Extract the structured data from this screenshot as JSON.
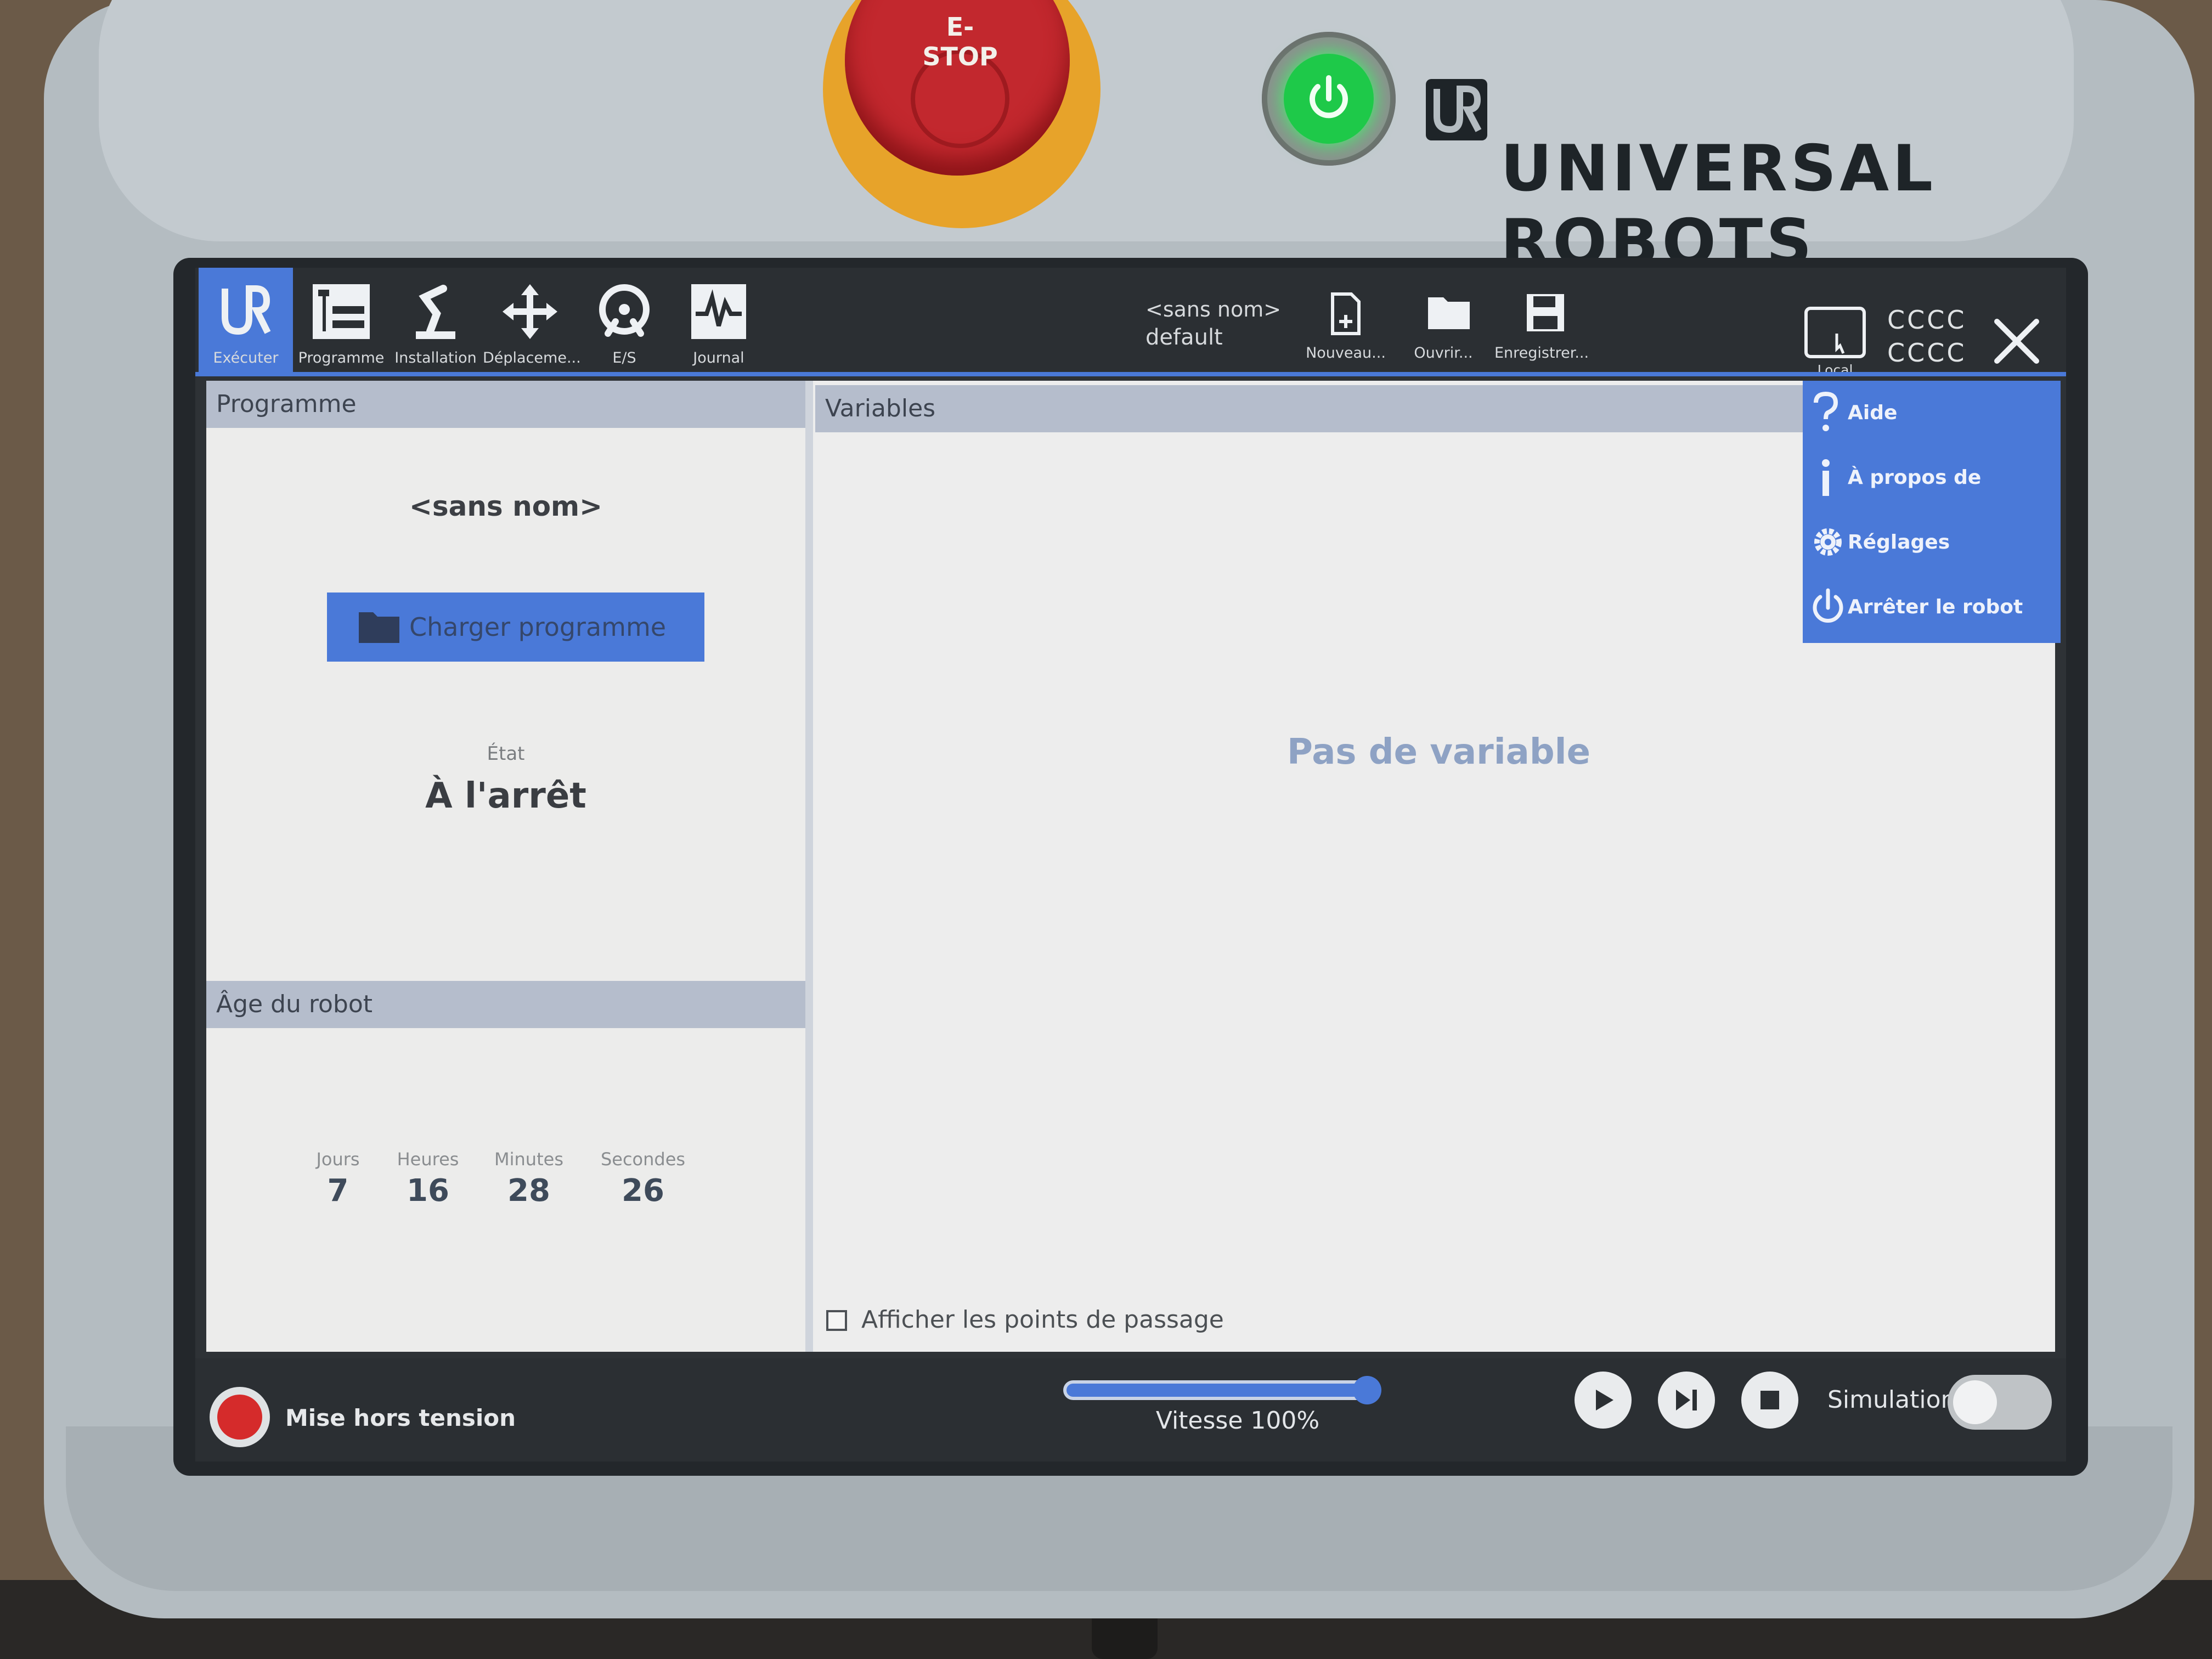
{
  "estop": {
    "label": "E-STOP"
  },
  "brand": {
    "name": "UNIVERSAL ROBOTS"
  },
  "tabs": [
    {
      "label": "Exécuter",
      "icon": "ur-logo-icon",
      "active": true
    },
    {
      "label": "Programme",
      "icon": "program-tree-icon"
    },
    {
      "label": "Installation",
      "icon": "robot-arm-icon"
    },
    {
      "label": "Déplaceme...",
      "icon": "move-arrows-icon"
    },
    {
      "label": "E/S",
      "icon": "io-icon"
    },
    {
      "label": "Journal",
      "icon": "log-wave-icon"
    }
  ],
  "program_header": {
    "name": "<sans nom>",
    "installation": "default"
  },
  "file_buttons": [
    {
      "label": "Nouveau...",
      "icon": "new-file-icon"
    },
    {
      "label": "Ouvrir...",
      "icon": "folder-icon"
    },
    {
      "label": "Enregistrer...",
      "icon": "save-icon"
    }
  ],
  "mode": {
    "label": "Local",
    "icon": "local-mode-icon"
  },
  "status_codes": {
    "line1": "CCCC",
    "line2": "CCCC"
  },
  "menu": [
    {
      "label": "Aide",
      "icon": "question-icon"
    },
    {
      "label": "À propos de",
      "icon": "info-icon"
    },
    {
      "label": "Réglages",
      "icon": "gear-icon"
    },
    {
      "label": "Arrêter le robot",
      "icon": "power-icon"
    }
  ],
  "program_panel": {
    "title": "Programme",
    "program_name": "<sans nom>",
    "load_button": "Charger programme",
    "state_label": "État",
    "state_value": "À l'arrêt"
  },
  "age_panel": {
    "title": "Âge du robot",
    "labels": {
      "days": "Jours",
      "hours": "Heures",
      "minutes": "Minutes",
      "seconds": "Secondes"
    },
    "values": {
      "days": "7",
      "hours": "16",
      "minutes": "28",
      "seconds": "26"
    }
  },
  "variables_panel": {
    "title": "Variables",
    "empty_text": "Pas de variable",
    "checkbox_label": "Afficher les points de passage",
    "checkbox_checked": false
  },
  "bottom_bar": {
    "power_off_label": "Mise hors tension",
    "speed_label": "Vitesse 100%",
    "speed_percent": 100,
    "simulation_label": "Simulation",
    "simulation_on": false
  },
  "colors": {
    "accent": "#4a79d8",
    "toolbar": "#2b2f33",
    "panel_header": "#b5bdcc",
    "estop": "#c2282e",
    "power_led": "#1ec949"
  }
}
